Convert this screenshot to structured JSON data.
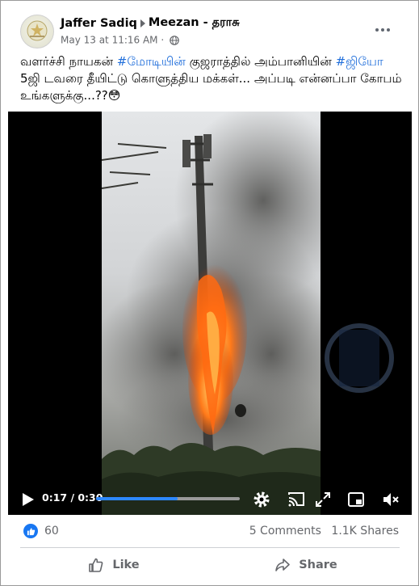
{
  "post": {
    "author": "Jaffer Sadiq",
    "group": "Meezan - தராசு",
    "timestamp": "May 13 at 11:16 AM",
    "dot": "·",
    "text": {
      "part1": "வளர்ச்சி நாயகன் ",
      "hashtag1": "#மோடியின்",
      "part2": " குஜராத்தில் அம்பானியின் ",
      "hashtag2": "#ஜியோ",
      "part3": " 5ஜி டவரை தீயிட்டு கொளுத்திய மக்கள்... அப்படி என்னப்பா கோபம் உங்களுக்கு...??😳"
    }
  },
  "video": {
    "time": "0:17 / 0:30",
    "progress": 0.57
  },
  "stats": {
    "reactions": "60",
    "comments": "5 Comments",
    "shares": "1.1K Shares"
  },
  "actions": {
    "like_label": "Like",
    "share_label": "Share"
  },
  "colors": {
    "facebook_blue": "#1877f2",
    "hashtag": "#216fdb",
    "progress_fill": "#2d88ff"
  }
}
